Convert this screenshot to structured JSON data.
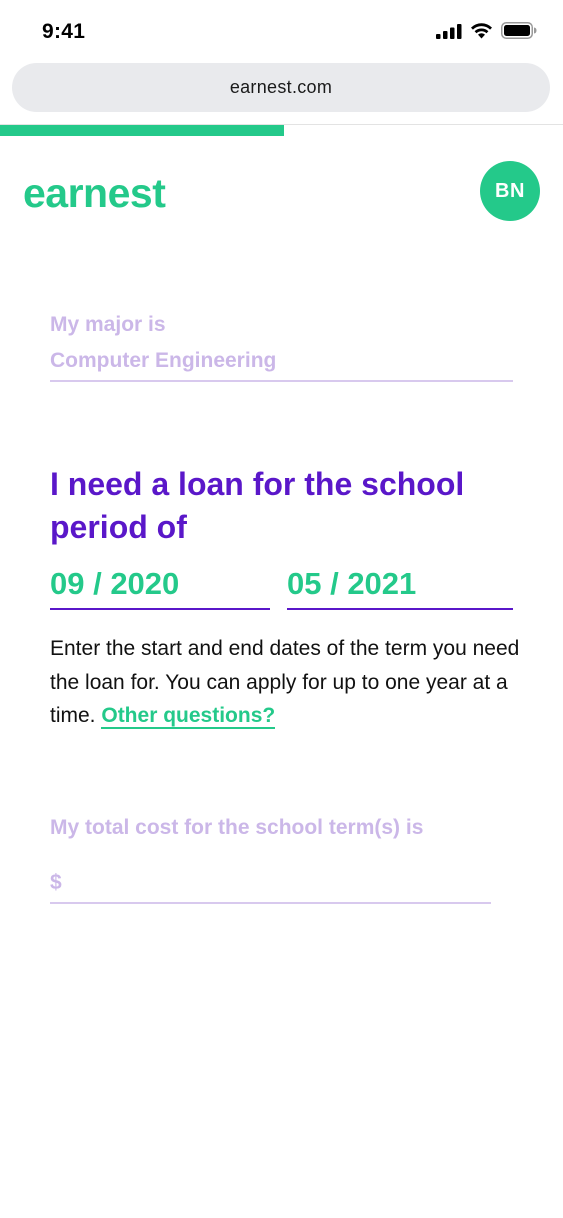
{
  "status_bar": {
    "time": "9:41",
    "icons": [
      "cellular-signal-icon",
      "wifi-icon",
      "battery-icon"
    ]
  },
  "browser": {
    "url": "earnest.com"
  },
  "progress": {
    "fraction": 0.505
  },
  "header": {
    "logo_text": "earnest",
    "avatar_initials": "BN"
  },
  "form": {
    "major": {
      "label": "My major is",
      "value": "Computer Engineering"
    },
    "loan_period": {
      "question": "I need a loan for the school period of",
      "start_date": "09 / 2020",
      "end_date": "05 / 2021",
      "help_text": "Enter the start and end dates of the term you need the loan for. You can apply for up to one year at a time.",
      "help_link": "Other questions?"
    },
    "total_cost": {
      "label": "My total cost for the school term(s) is",
      "placeholder": "$"
    }
  },
  "colors": {
    "brand_green": "#24c98a",
    "brand_purple": "#5a17c9",
    "muted_lavender": "#cbb7e8"
  }
}
